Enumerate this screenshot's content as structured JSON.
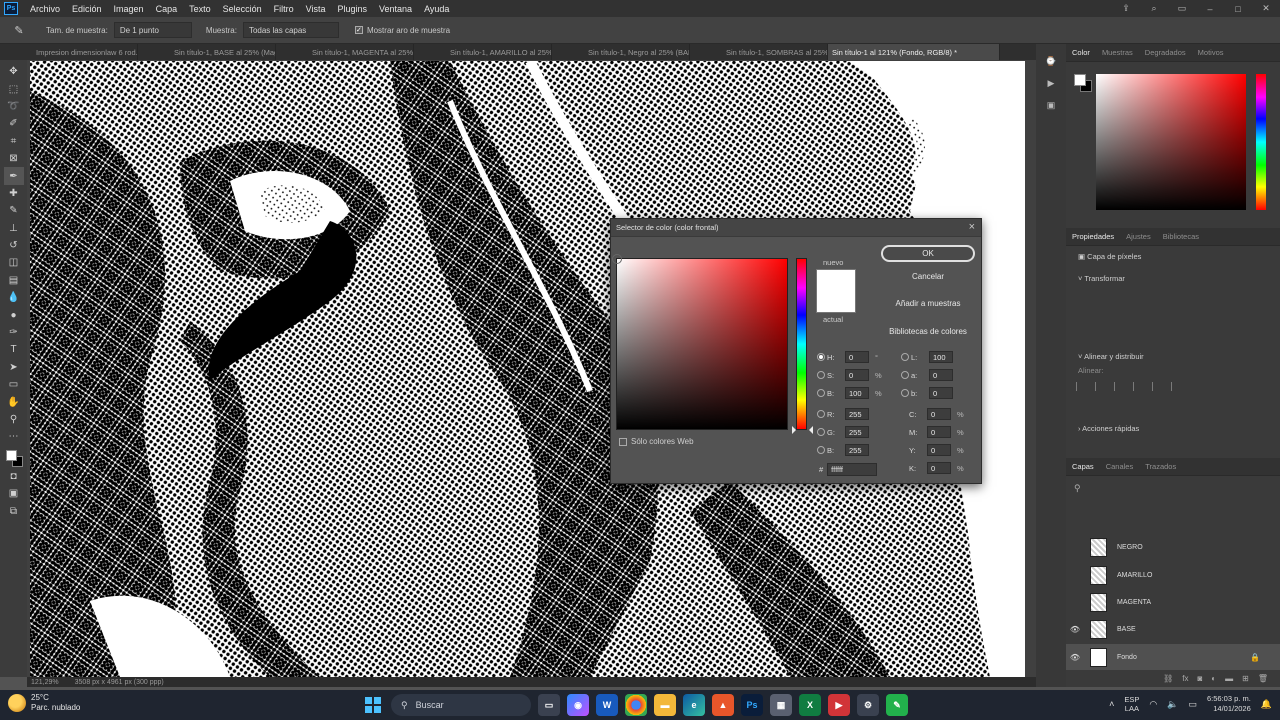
{
  "menubar": {
    "items": [
      "Archivo",
      "Edición",
      "Imagen",
      "Capa",
      "Texto",
      "Selección",
      "Filtro",
      "Vista",
      "Plugins",
      "Ventana",
      "Ayuda"
    ]
  },
  "options_bar": {
    "sample_size_label": "Tam. de muestra:",
    "sample_size_value": "De 1 punto",
    "sample_label": "Muestra:",
    "sample_value": "Todas las capas",
    "show_ring_label": "Mostrar aro de muestra"
  },
  "tabs": [
    "Impresion dimensionlaw 6 rod.psd",
    "Sin título-1, BASE al 25% (Mag...",
    "Sin título-1, MAGENTA al 25% (...",
    "Sin título-1, AMARILLO al 25% (...",
    "Sin título-1, Negro al 25% (BAL...",
    "Sin título-1, SOMBRAS al 25% (...",
    "Sin título-1 al 121% (Fondo, RGB/8) *"
  ],
  "status": {
    "zoom": "121,29%",
    "doc_info": "3508 px x 4961 px (300 ppp)"
  },
  "color_panel": {
    "tabs": [
      "Color",
      "Muestras",
      "Degradados",
      "Motivos"
    ]
  },
  "properties_panel": {
    "tabs": [
      "Propiedades",
      "Ajustes",
      "Bibliotecas"
    ],
    "layer_type": "Capa de píxeles",
    "transform_label": "Transformar",
    "align_label": "Alinear y distribuir",
    "align_sub": "Alinear:",
    "quick_actions_label": "Acciones rápidas"
  },
  "layers_panel": {
    "tabs": [
      "Capas",
      "Canales",
      "Trazados"
    ],
    "layers": [
      {
        "name": "NEGRO",
        "visible": false,
        "selected": false
      },
      {
        "name": "AMARILLO",
        "visible": false,
        "selected": false
      },
      {
        "name": "MAGENTA",
        "visible": false,
        "selected": false
      },
      {
        "name": "BASE",
        "visible": true,
        "selected": false
      },
      {
        "name": "Fondo",
        "visible": true,
        "selected": true
      }
    ]
  },
  "dialog": {
    "title": "Selector de color (color frontal)",
    "close_symbol": "×",
    "new_label": "nuevo",
    "current_label": "actual",
    "ok_label": "OK",
    "cancel_label": "Cancelar",
    "add_swatch_label": "Añadir a muestras",
    "libraries_label": "Bibliotecas de colores",
    "web_only_label": "Sólo colores Web",
    "new_color": "#ffffff",
    "current_color": "#ffffff",
    "fields": {
      "H": {
        "label": "H:",
        "value": "0",
        "unit": "°"
      },
      "S": {
        "label": "S:",
        "value": "0",
        "unit": "%"
      },
      "B": {
        "label": "B:",
        "value": "100",
        "unit": "%"
      },
      "R": {
        "label": "R:",
        "value": "255"
      },
      "G": {
        "label": "G:",
        "value": "255"
      },
      "Bl": {
        "label": "B:",
        "value": "255"
      },
      "L": {
        "label": "L:",
        "value": "100"
      },
      "a": {
        "label": "a:",
        "value": "0"
      },
      "b": {
        "label": "b:",
        "value": "0"
      },
      "C": {
        "label": "C:",
        "value": "0",
        "unit": "%"
      },
      "M": {
        "label": "M:",
        "value": "0",
        "unit": "%"
      },
      "Y": {
        "label": "Y:",
        "value": "0",
        "unit": "%"
      },
      "K": {
        "label": "K:",
        "value": "0",
        "unit": "%"
      }
    },
    "hex_label": "#",
    "hex_value": "ffffff"
  },
  "taskbar": {
    "temperature": "25°C",
    "weather_desc": "Parc. nublado",
    "search_placeholder": "Buscar",
    "lang_top": "ESP",
    "lang_bottom": "LAA",
    "time": "6:56:03 p. m.",
    "date": "14/01/2026"
  }
}
